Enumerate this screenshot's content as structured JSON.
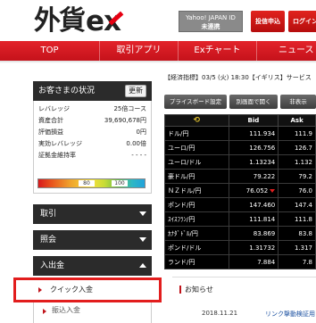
{
  "header": {
    "logo_jp": "外貨",
    "logo_ex": "ex",
    "yj_label": "Yahoo! JAPAN ID",
    "yj_status": "未連携",
    "deposit_btn": "投信申込",
    "login_btn": "ログイン"
  },
  "nav": {
    "items": [
      {
        "label": "TOP"
      },
      {
        "label": "取引アプリ"
      },
      {
        "label": "Exチャート"
      },
      {
        "label": "ニュース"
      }
    ]
  },
  "account": {
    "title": "お客さまの状況",
    "refresh": "更新",
    "rows": [
      {
        "label": "レバレッジ",
        "value": "25倍コース"
      },
      {
        "label": "資産合計",
        "value": "39,690,678円"
      },
      {
        "label": "評価損益",
        "value": "0円"
      },
      {
        "label": "実効レバレッジ",
        "value": "0.00倍"
      },
      {
        "label": "証拠金維持率",
        "value": "- - - -"
      }
    ],
    "bar_labels": [
      "80",
      "100"
    ]
  },
  "menu": {
    "trade": "取引",
    "inquiry": "照会",
    "deposit": "入出金",
    "quick_deposit": "クイック入金",
    "withdraw": "振込入金"
  },
  "right": {
    "news_head": "【経済指標】03/5 (火) 18:30【イギリス】サービス",
    "btn_price_board": "プライスボード設定",
    "btn_new_window": "別画面で開く",
    "btn_hide": "非表示",
    "table": {
      "col_bid": "Bid",
      "col_ask": "Ask",
      "rows": [
        {
          "pair": "ドル/円",
          "bid": "111.93",
          "bid_small": "4",
          "ask": "111.9"
        },
        {
          "pair": "ユーロ/円",
          "bid": "126.75",
          "bid_small": "6",
          "ask": "126.7"
        },
        {
          "pair": "ユーロ/ドル",
          "bid": "1.1323",
          "bid_small": "4",
          "ask": "1.132"
        },
        {
          "pair": "豪ドル/円",
          "bid": "79.22",
          "bid_small": "2",
          "ask": "79.2"
        },
        {
          "pair": "ＮＺドル/円",
          "bid": "76.05",
          "bid_small": "2",
          "ask": "76.0"
        },
        {
          "pair": "ポンド/円",
          "bid": "147.46",
          "bid_small": "0",
          "ask": "147.4"
        },
        {
          "pair": "ｽｲｽﾌﾗﾝ/円",
          "bid": "111.81",
          "bid_small": "4",
          "ask": "111.8"
        },
        {
          "pair": "ｶﾅﾀﾞﾄﾞﾙ/円",
          "bid": "83.86",
          "bid_small": "9",
          "ask": "83.8"
        },
        {
          "pair": "ポンド/ドル",
          "bid": "1.3173",
          "bid_small": "2",
          "ask": "1.317"
        },
        {
          "pair": "ランド/円",
          "bid": "7.88",
          "bid_small": "4",
          "ask": "7.8"
        }
      ]
    },
    "notice_title": "お知らせ",
    "notice_date": "2018.11.21",
    "notice_link": "リンク撃動検証用"
  }
}
